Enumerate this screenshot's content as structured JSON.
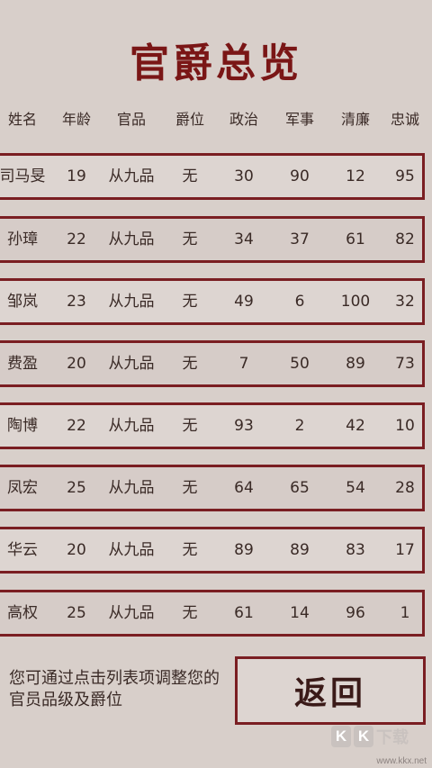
{
  "page": {
    "title": "官爵总览",
    "hint": "您可通过点击列表项调整您的官员品级及爵位",
    "back_label": "返回"
  },
  "table": {
    "headers": [
      "姓名",
      "年龄",
      "官品",
      "爵位",
      "政治",
      "军事",
      "清廉",
      "忠诚"
    ],
    "rows": [
      [
        "司马旻",
        "19",
        "从九品",
        "无",
        "30",
        "90",
        "12",
        "95"
      ],
      [
        "孙璋",
        "22",
        "从九品",
        "无",
        "34",
        "37",
        "61",
        "82"
      ],
      [
        "邹岚",
        "23",
        "从九品",
        "无",
        "49",
        "6",
        "100",
        "32"
      ],
      [
        "费盈",
        "20",
        "从九品",
        "无",
        "7",
        "50",
        "89",
        "73"
      ],
      [
        "陶博",
        "22",
        "从九品",
        "无",
        "93",
        "2",
        "42",
        "10"
      ],
      [
        "凤宏",
        "25",
        "从九品",
        "无",
        "64",
        "65",
        "54",
        "28"
      ],
      [
        "华云",
        "20",
        "从九品",
        "无",
        "89",
        "89",
        "83",
        "17"
      ],
      [
        "高权",
        "25",
        "从九品",
        "无",
        "61",
        "14",
        "96",
        "1"
      ]
    ]
  },
  "watermark": {
    "badges": [
      "K",
      "K"
    ],
    "text": "下载",
    "url": "www.kkx.net"
  },
  "colors": {
    "background": "#d8cfca",
    "accent": "#7a1616",
    "border": "#7a1e22"
  }
}
